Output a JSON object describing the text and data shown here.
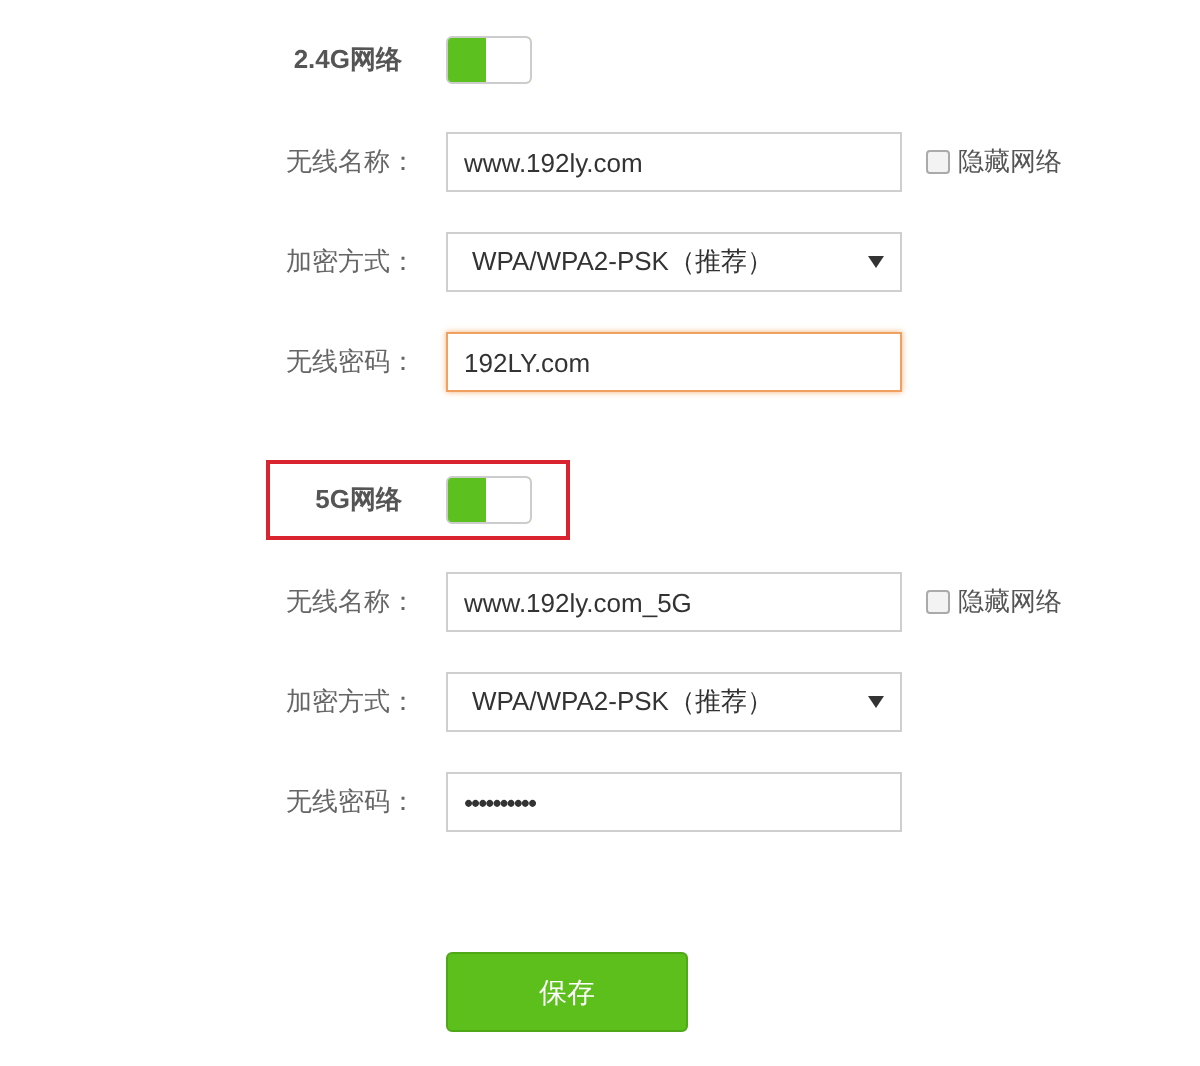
{
  "sections": [
    {
      "title": "2.4G网络",
      "on": true,
      "highlighted": false,
      "fields": [
        {
          "kind": "text",
          "label": "无线名称：",
          "value": "www.192ly.com",
          "focused": false,
          "checkbox": {
            "label": "隐藏网络",
            "checked": false
          }
        },
        {
          "kind": "select",
          "label": "加密方式：",
          "value": "WPA/WPA2-PSK（推荐）",
          "focused": false
        },
        {
          "kind": "text",
          "label": "无线密码：",
          "value": "192LY.com",
          "focused": true
        }
      ]
    },
    {
      "title": "5G网络",
      "on": true,
      "highlighted": true,
      "fields": [
        {
          "kind": "text",
          "label": "无线名称：",
          "value": "www.192ly.com_5G",
          "focused": false,
          "checkbox": {
            "label": "隐藏网络",
            "checked": false
          }
        },
        {
          "kind": "select",
          "label": "加密方式：",
          "value": "WPA/WPA2-PSK（推荐）",
          "focused": false
        },
        {
          "kind": "password",
          "label": "无线密码：",
          "value": "••••••••••",
          "focused": false
        }
      ]
    }
  ],
  "save_button": "保存"
}
